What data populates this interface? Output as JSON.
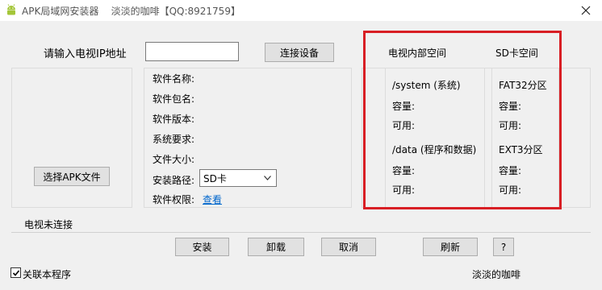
{
  "window": {
    "title": "APK局域网安装器    淡淡的咖啡【QQ:8921759】",
    "close_icon": "close-icon"
  },
  "connect": {
    "ip_label": "请输入电视IP地址",
    "ip_value": "",
    "connect_button": "连接设备"
  },
  "choose_apk_button": "选择APK文件",
  "info": {
    "name_label": "软件名称:",
    "package_label": "软件包名:",
    "version_label": "软件版本:",
    "requirement_label": "系统要求:",
    "size_label": "文件大小:",
    "install_path_label": "安装路径:",
    "install_path_value": "SD卡",
    "permission_label": "软件权限:",
    "permission_link": "查看"
  },
  "storage": {
    "internal_header": "电视内部空间",
    "sd_header": "SD卡空间",
    "system_label": "/system (系统)",
    "data_label": "/data (程序和数据)",
    "fat32_label": "FAT32分区",
    "ext3_label": "EXT3分区",
    "capacity_label": "容量:",
    "available_label": "可用:"
  },
  "status": {
    "text": "电视未连接"
  },
  "actions": {
    "install": "安装",
    "uninstall": "卸载",
    "cancel": "取消",
    "refresh": "刷新",
    "help": "?"
  },
  "footer": {
    "associate_label": "关联本程序",
    "associate_checked": true,
    "author": "淡淡的咖啡"
  }
}
